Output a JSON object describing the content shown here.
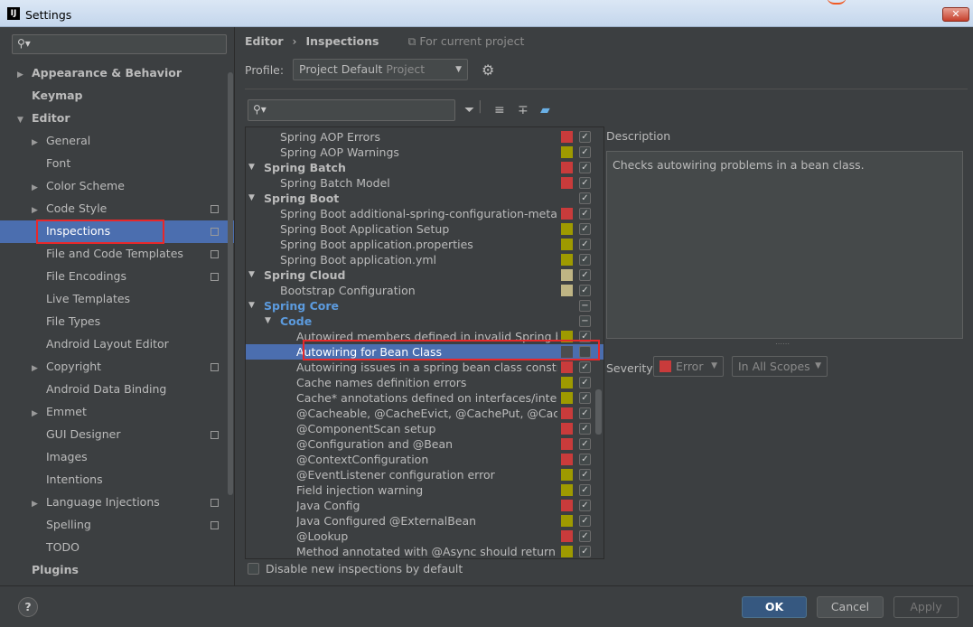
{
  "window": {
    "title": "Settings",
    "app_icon": "IJ",
    "close_label": "✕"
  },
  "left": {
    "search_placeholder": "",
    "items": [
      {
        "label": "Appearance & Behavior",
        "arrow": "▶",
        "bold": true
      },
      {
        "label": "Keymap",
        "arrow": "",
        "bold": true
      },
      {
        "label": "Editor",
        "arrow": "▼",
        "bold": true
      },
      {
        "label": "General",
        "arrow": "▶",
        "bold": false
      },
      {
        "label": "Font",
        "arrow": "",
        "bold": false
      },
      {
        "label": "Color Scheme",
        "arrow": "▶",
        "bold": false
      },
      {
        "label": "Code Style",
        "arrow": "▶",
        "bold": false,
        "copy": true
      },
      {
        "label": "Inspections",
        "arrow": "",
        "bold": false,
        "copy": true,
        "selected": true
      },
      {
        "label": "File and Code Templates",
        "arrow": "",
        "bold": false,
        "copy": true
      },
      {
        "label": "File Encodings",
        "arrow": "",
        "bold": false,
        "copy": true
      },
      {
        "label": "Live Templates",
        "arrow": "",
        "bold": false
      },
      {
        "label": "File Types",
        "arrow": "",
        "bold": false
      },
      {
        "label": "Android Layout Editor",
        "arrow": "",
        "bold": false
      },
      {
        "label": "Copyright",
        "arrow": "▶",
        "bold": false,
        "copy": true
      },
      {
        "label": "Android Data Binding",
        "arrow": "",
        "bold": false
      },
      {
        "label": "Emmet",
        "arrow": "▶",
        "bold": false
      },
      {
        "label": "GUI Designer",
        "arrow": "",
        "bold": false,
        "copy": true
      },
      {
        "label": "Images",
        "arrow": "",
        "bold": false
      },
      {
        "label": "Intentions",
        "arrow": "",
        "bold": false
      },
      {
        "label": "Language Injections",
        "arrow": "▶",
        "bold": false,
        "copy": true
      },
      {
        "label": "Spelling",
        "arrow": "",
        "bold": false,
        "copy": true
      },
      {
        "label": "TODO",
        "arrow": "",
        "bold": false
      },
      {
        "label": "Plugins",
        "arrow": "",
        "bold": true
      }
    ]
  },
  "breadcrumb": {
    "parent": "Editor",
    "separator": "›",
    "current": "Inspections",
    "scope_icon": "⧉",
    "scope": "For current project"
  },
  "profile": {
    "label": "Profile:",
    "name": "Project Default",
    "sub": "Project",
    "dropdown": "▼"
  },
  "inspections": {
    "search_placeholder": "",
    "rows": [
      {
        "label": "Spring AOP Errors",
        "level": 2,
        "sev": "#c93b3b",
        "check": "✓"
      },
      {
        "label": "Spring AOP Warnings",
        "level": 2,
        "sev": "#9e9a00",
        "check": "✓"
      },
      {
        "label": "Spring Batch",
        "level": 1,
        "group": true,
        "arrow": "▼",
        "sev": "#c93b3b",
        "check": "✓"
      },
      {
        "label": "Spring Batch Model",
        "level": 2,
        "sev": "#c93b3b",
        "check": "✓"
      },
      {
        "label": "Spring Boot",
        "level": 1,
        "group": true,
        "arrow": "▼",
        "sev": "",
        "check": "✓"
      },
      {
        "label": "Spring Boot additional-spring-configuration-metadat",
        "level": 2,
        "sev": "#c93b3b",
        "check": "✓"
      },
      {
        "label": "Spring Boot Application Setup",
        "level": 2,
        "sev": "#9e9a00",
        "check": "✓"
      },
      {
        "label": "Spring Boot application.properties",
        "level": 2,
        "sev": "#9e9a00",
        "check": "✓"
      },
      {
        "label": "Spring Boot application.yml",
        "level": 2,
        "sev": "#9e9a00",
        "check": "✓"
      },
      {
        "label": "Spring Cloud",
        "level": 1,
        "group": true,
        "arrow": "▼",
        "sev": "#bfb584",
        "check": "✓"
      },
      {
        "label": "Bootstrap Configuration",
        "level": 2,
        "sev": "#bfb584",
        "check": "✓"
      },
      {
        "label": "Spring Core",
        "level": 1,
        "group": true,
        "blue": true,
        "arrow": "▼",
        "sev": "",
        "check": "−"
      },
      {
        "label": "Code",
        "level": 2,
        "group": true,
        "blue": true,
        "arrow": "▼",
        "sev": "",
        "check": "−"
      },
      {
        "label": "Autowired members defined in invalid Spring bean",
        "level": 3,
        "sev": "#9e9a00",
        "check": "✓"
      },
      {
        "label": "Autowiring for Bean Class",
        "level": 3,
        "sev": "#4b4d4f",
        "check": "",
        "selected": true
      },
      {
        "label": "Autowiring issues in a spring bean class constructor",
        "level": 3,
        "sev": "#c93b3b",
        "check": "✓"
      },
      {
        "label": "Cache names definition errors",
        "level": 3,
        "sev": "#9e9a00",
        "check": "✓"
      },
      {
        "label": "Cache* annotations defined on interfaces/interface",
        "level": 3,
        "sev": "#9e9a00",
        "check": "✓"
      },
      {
        "label": "@Cacheable, @CacheEvict, @CachePut, @CacheConfig",
        "level": 3,
        "sev": "#c93b3b",
        "check": "✓"
      },
      {
        "label": "@ComponentScan setup",
        "level": 3,
        "sev": "#c93b3b",
        "check": "✓"
      },
      {
        "label": "@Configuration and @Bean",
        "level": 3,
        "sev": "#c93b3b",
        "check": "✓"
      },
      {
        "label": "@ContextConfiguration",
        "level": 3,
        "sev": "#c93b3b",
        "check": "✓"
      },
      {
        "label": "@EventListener configuration error",
        "level": 3,
        "sev": "#9e9a00",
        "check": "✓"
      },
      {
        "label": "Field injection warning",
        "level": 3,
        "sev": "#9e9a00",
        "check": "✓"
      },
      {
        "label": "Java Config",
        "level": 3,
        "sev": "#c93b3b",
        "check": "✓"
      },
      {
        "label": "Java Configured @ExternalBean",
        "level": 3,
        "sev": "#9e9a00",
        "check": "✓"
      },
      {
        "label": "@Lookup",
        "level": 3,
        "sev": "#c93b3b",
        "check": "✓"
      },
      {
        "label": "Method annotated with @Async should return void",
        "level": 3,
        "sev": "#9e9a00",
        "check": "✓"
      }
    ]
  },
  "description": {
    "label": "Description",
    "text": "Checks autowiring problems in a bean class."
  },
  "severity": {
    "label": "Severity:",
    "value": "Error",
    "scope": "In All Scopes",
    "color": "#c93b3b",
    "dropdown": "▼"
  },
  "disable_new": "Disable new inspections by default",
  "buttons": {
    "help": "?",
    "ok": "OK",
    "cancel": "Cancel",
    "apply": "Apply"
  }
}
